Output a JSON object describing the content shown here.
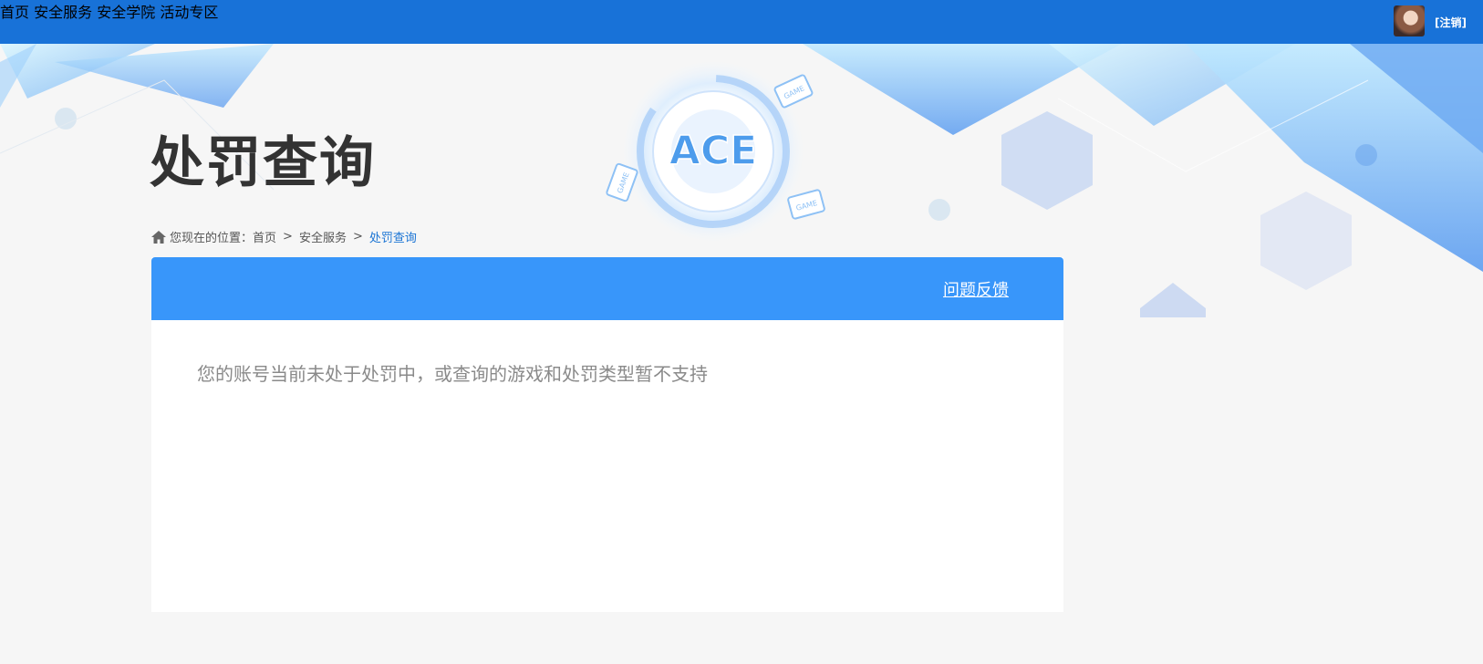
{
  "nav": {
    "items": [
      {
        "label": "首页"
      },
      {
        "label": "安全服务"
      },
      {
        "label": "安全学院"
      },
      {
        "label": "活动专区"
      }
    ],
    "logout_label": "[注销]"
  },
  "page": {
    "title": "处罚查询"
  },
  "breadcrumb": {
    "prefix": "您现在的位置：",
    "items": [
      "首页",
      "安全服务",
      "处罚查询"
    ],
    "separator": ">"
  },
  "panel": {
    "feedback_label": "问题反馈",
    "message": "您的账号当前未处于处罚中，或查询的游戏和处罚类型暂不支持"
  },
  "banner": {
    "logo_text": "ACE",
    "badge_text": "GAME"
  },
  "colors": {
    "topbar": "#1872d8",
    "panel_header": "#3896fa",
    "breadcrumb_current": "#1b74d4",
    "page_bg": "#f6f6f6"
  }
}
